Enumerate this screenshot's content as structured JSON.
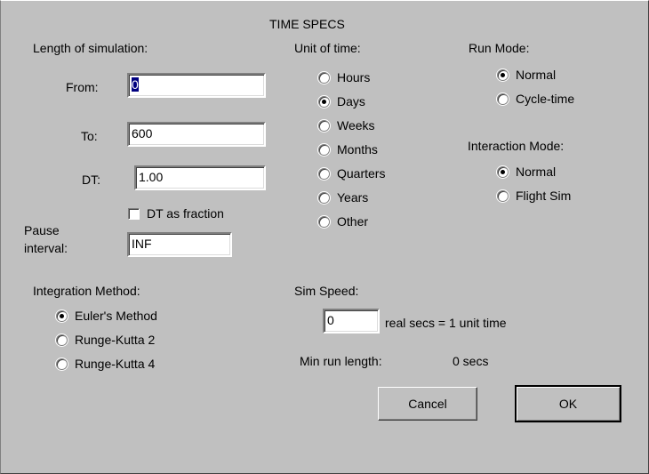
{
  "title": "TIME SPECS",
  "length": {
    "heading": "Length of simulation:",
    "from_label": "From:",
    "from_value": "0",
    "to_label": "To:",
    "to_value": "600",
    "dt_label": "DT:",
    "dt_value": "1.00",
    "dt_fraction_label": "DT as fraction",
    "pause_label_1": "Pause",
    "pause_label_2": "interval:",
    "pause_value": "INF"
  },
  "unit_of_time": {
    "heading": "Unit of time:",
    "options": [
      "Hours",
      "Days",
      "Weeks",
      "Months",
      "Quarters",
      "Years",
      "Other"
    ],
    "selected": "Days"
  },
  "run_mode": {
    "heading": "Run Mode:",
    "options": [
      "Normal",
      "Cycle-time"
    ],
    "selected": "Normal"
  },
  "interaction_mode": {
    "heading": "Interaction Mode:",
    "options": [
      "Normal",
      "Flight Sim"
    ],
    "selected": "Normal"
  },
  "integration": {
    "heading": "Integration Method:",
    "options": [
      "Euler's Method",
      "Runge-Kutta 2",
      "Runge-Kutta 4"
    ],
    "selected": "Euler's Method"
  },
  "sim_speed": {
    "heading": "Sim Speed:",
    "value": "0",
    "suffix": "real secs = 1 unit time",
    "min_run_label": "Min run length:",
    "min_run_value": "0 secs"
  },
  "buttons": {
    "cancel": "Cancel",
    "ok": "OK"
  }
}
